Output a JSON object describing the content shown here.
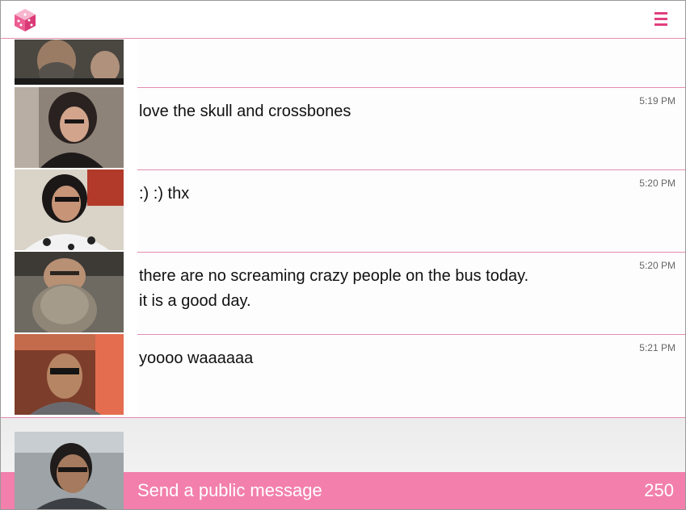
{
  "header": {
    "logo_icon": "pink-cube-logo-icon",
    "menu_icon": "hamburger-menu-icon",
    "accent": "#e0407e"
  },
  "messages": [
    {
      "text": "",
      "time": ""
    },
    {
      "text": "love the skull and crossbones",
      "time": "5:19 PM"
    },
    {
      "text": ":) :) thx",
      "time": "5:20 PM"
    },
    {
      "text_line1": "there are no screaming crazy people on the bus today.",
      "text_line2": "it is a good day.",
      "time": "5:20 PM"
    },
    {
      "text": "yoooo waaaaaa",
      "time": "5:21 PM"
    }
  ],
  "compose": {
    "placeholder": "Send a public message",
    "remaining": "250",
    "bar_color": "#f27fac"
  }
}
